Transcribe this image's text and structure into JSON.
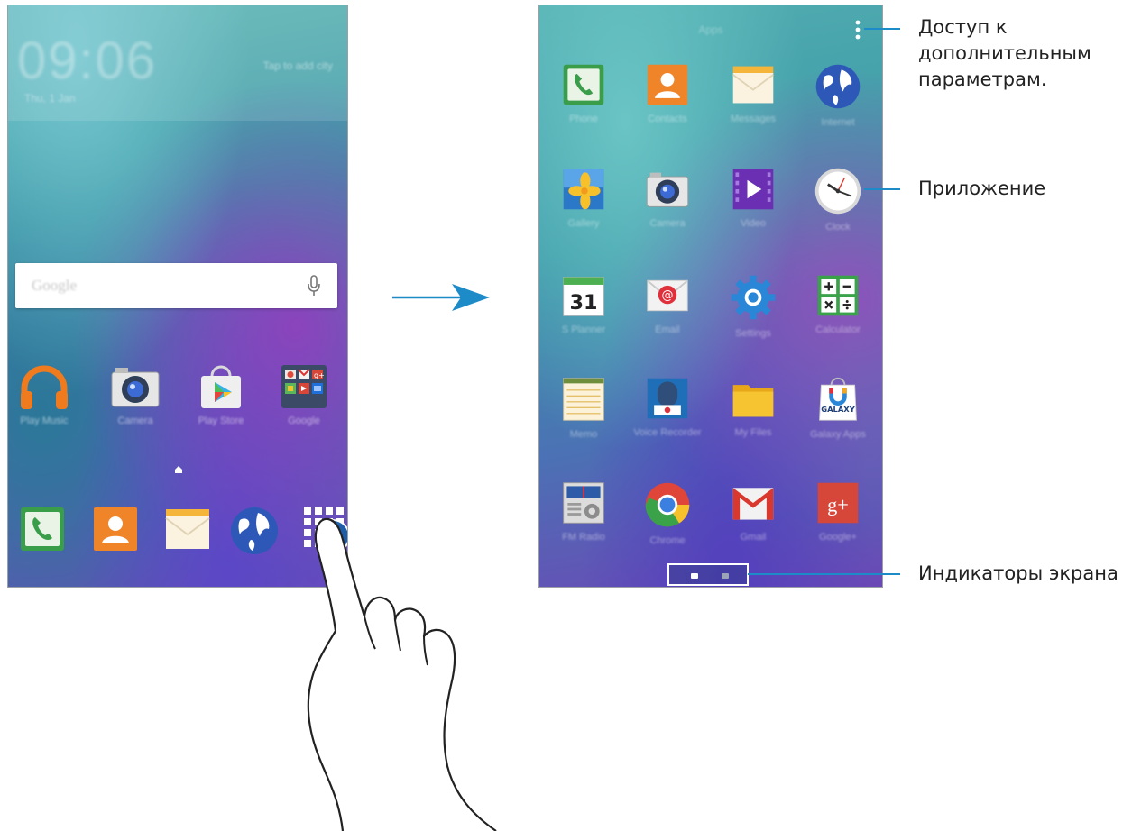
{
  "home_screen": {
    "clock": {
      "time": "09:06",
      "date": "Thu, 1 Jan",
      "city_hint": "Tap to add city"
    },
    "search": {
      "placeholder": "Google"
    },
    "row_apps": [
      {
        "label": "Play Music",
        "icon": "headphones-icon"
      },
      {
        "label": "Camera",
        "icon": "camera-icon"
      },
      {
        "label": "Play Store",
        "icon": "play-store-icon"
      },
      {
        "label": "Google",
        "icon": "google-folder-icon"
      }
    ],
    "dock_apps": [
      {
        "label": "Phone",
        "icon": "phone-icon"
      },
      {
        "label": "Contacts",
        "icon": "contacts-icon"
      },
      {
        "label": "Messages",
        "icon": "messages-icon"
      },
      {
        "label": "Internet",
        "icon": "globe-icon"
      },
      {
        "label": "Apps",
        "icon": "apps-grid-icon"
      }
    ]
  },
  "apps_screen": {
    "title": "Apps",
    "apps": [
      {
        "label": "Phone",
        "icon": "phone-icon"
      },
      {
        "label": "Contacts",
        "icon": "contacts-icon"
      },
      {
        "label": "Messages",
        "icon": "messages-icon"
      },
      {
        "label": "Internet",
        "icon": "globe-icon"
      },
      {
        "label": "Gallery",
        "icon": "gallery-icon"
      },
      {
        "label": "Camera",
        "icon": "camera-icon"
      },
      {
        "label": "Video",
        "icon": "video-icon"
      },
      {
        "label": "Clock",
        "icon": "clock-icon"
      },
      {
        "label": "S Planner",
        "icon": "calendar-icon",
        "badge": "31"
      },
      {
        "label": "Email",
        "icon": "email-icon"
      },
      {
        "label": "Settings",
        "icon": "settings-gear-icon"
      },
      {
        "label": "Calculator",
        "icon": "calculator-icon"
      },
      {
        "label": "Memo",
        "icon": "memo-icon"
      },
      {
        "label": "Voice Recorder",
        "icon": "voice-recorder-icon"
      },
      {
        "label": "My Files",
        "icon": "folder-icon"
      },
      {
        "label": "Galaxy Apps",
        "icon": "galaxy-apps-icon",
        "badge": "GALAXY"
      },
      {
        "label": "FM Radio",
        "icon": "radio-icon"
      },
      {
        "label": "Chrome",
        "icon": "chrome-icon"
      },
      {
        "label": "Gmail",
        "icon": "gmail-icon"
      },
      {
        "label": "Google+",
        "icon": "google-plus-icon",
        "badge": "g+"
      }
    ],
    "page_count": 2,
    "current_page": 1
  },
  "callouts": {
    "more_options": "Доступ к дополнительным параметрам.",
    "application": "Приложение",
    "screen_indicators": "Индикаторы экрана"
  },
  "colors": {
    "callout_line": "#1d8bc8",
    "arrow": "#1d8bc8"
  }
}
